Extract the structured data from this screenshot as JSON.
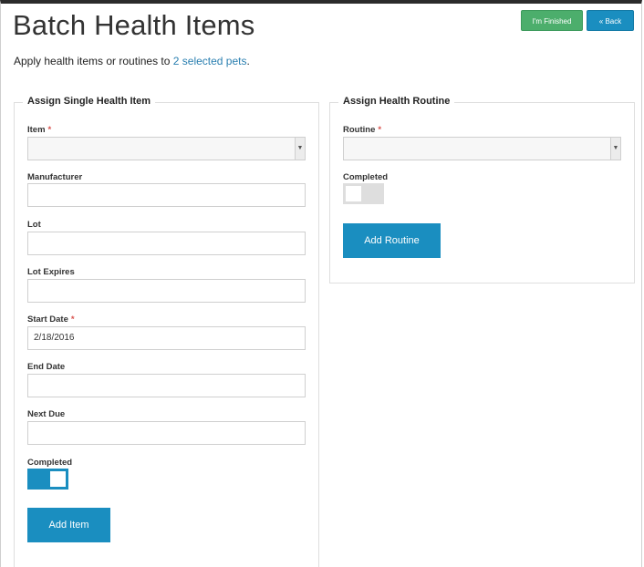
{
  "header": {
    "title": "Batch Health Items",
    "finished_label": "I'm Finished",
    "back_label": "« Back"
  },
  "subtitle": {
    "prefix": "Apply health items or routines to ",
    "link_text": "2 selected pets",
    "suffix": "."
  },
  "single_item": {
    "legend": "Assign Single Health Item",
    "item_label": "Item",
    "required_mark": "*",
    "item_value": "",
    "manufacturer_label": "Manufacturer",
    "manufacturer_value": "",
    "lot_label": "Lot",
    "lot_value": "",
    "lot_expires_label": "Lot Expires",
    "lot_expires_value": "",
    "start_date_label": "Start Date",
    "start_date_value": "2/18/2016",
    "end_date_label": "End Date",
    "end_date_value": "",
    "next_due_label": "Next Due",
    "next_due_value": "",
    "completed_label": "Completed",
    "completed": true,
    "add_button": "Add Item"
  },
  "routine": {
    "legend": "Assign Health Routine",
    "routine_label": "Routine",
    "required_mark": "*",
    "routine_value": "",
    "completed_label": "Completed",
    "completed": false,
    "add_button": "Add Routine"
  },
  "colors": {
    "accent": "#1a8ec0",
    "success": "#4cae6c",
    "required": "#d9534f",
    "link": "#2a7fb0"
  }
}
